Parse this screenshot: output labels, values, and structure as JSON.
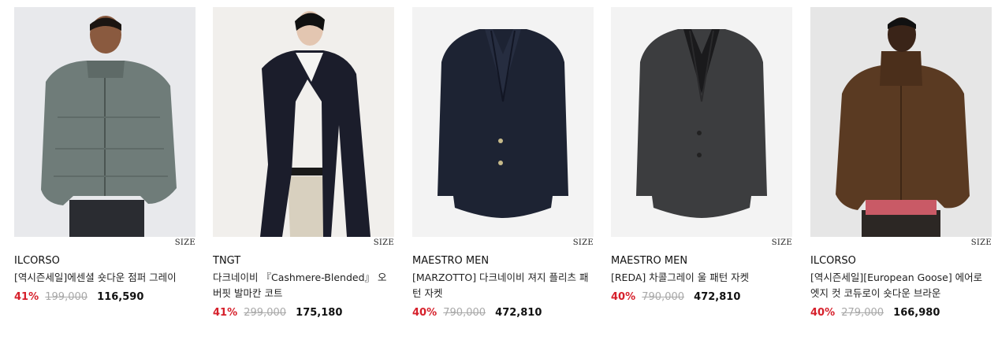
{
  "size_label": "SIZE",
  "products": [
    {
      "brand": "ILCORSO",
      "title": "[역시즌세일]에센셜 숏다운 점퍼 그레이",
      "discount": "41%",
      "original_price": "199,000",
      "sale_price": "116,590",
      "colors": {
        "bg": "#e8e9ec",
        "garment": "#6f7c79"
      }
    },
    {
      "brand": "TNGT",
      "title": "다크네이비 『Cashmere-Blended』 오버핏 발마칸 코트",
      "discount": "41%",
      "original_price": "299,000",
      "sale_price": "175,180",
      "colors": {
        "bg": "#f1efec",
        "garment": "#1b1d2b"
      }
    },
    {
      "brand": "MAESTRO MEN",
      "title": "[MARZOTTO] 다크네이비 져지 플리츠 패턴 자켓",
      "discount": "40%",
      "original_price": "790,000",
      "sale_price": "472,810",
      "colors": {
        "bg": "#f3f3f3",
        "garment": "#1d2333"
      }
    },
    {
      "brand": "MAESTRO MEN",
      "title": "[REDA] 차콜그레이 울 패턴 자켓",
      "discount": "40%",
      "original_price": "790,000",
      "sale_price": "472,810",
      "colors": {
        "bg": "#f3f3f3",
        "garment": "#3c3d3f"
      }
    },
    {
      "brand": "ILCORSO",
      "title": "[역시즌세일][European Goose] 에어로 엣지 컷 코듀로이 숏다운 브라운",
      "discount": "40%",
      "original_price": "279,000",
      "sale_price": "166,980",
      "colors": {
        "bg": "#e6e6e6",
        "garment": "#5a3a22"
      }
    }
  ]
}
